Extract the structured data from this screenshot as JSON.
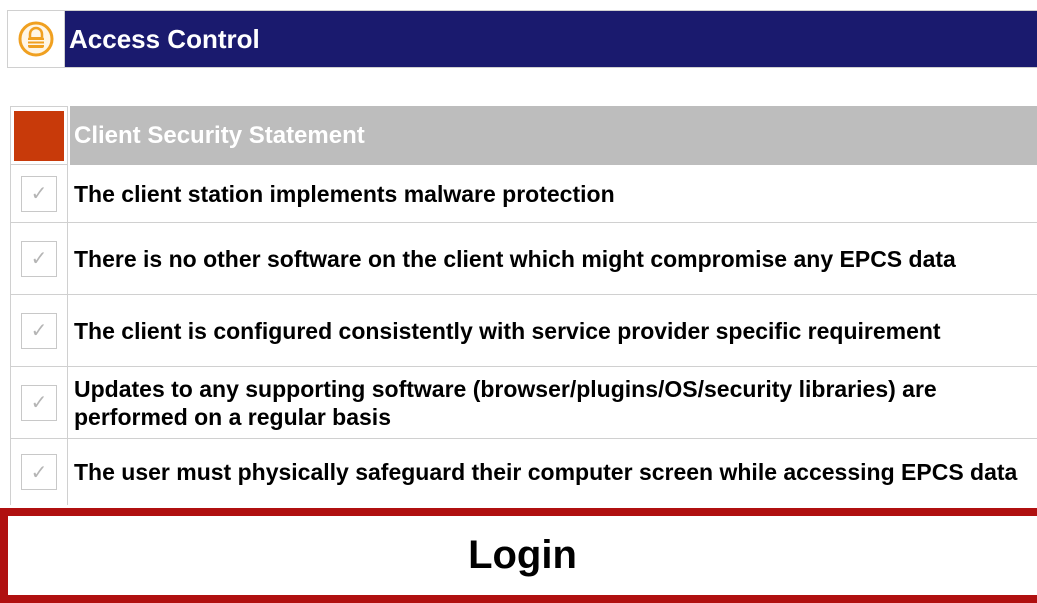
{
  "header": {
    "title": "Access Control",
    "icon": "lock-icon",
    "icon_color": "#f0a020",
    "bar_color": "#1a1a6e"
  },
  "statement": {
    "title": "Client Security Statement",
    "accent_color": "#c83a0a",
    "items": [
      {
        "text": "The client station implements malware protection",
        "checked": true
      },
      {
        "text": "There is no other software on the client which might compromise any EPCS data",
        "checked": true
      },
      {
        "text": "The client is configured consistently with service provider specific requirement",
        "checked": true
      },
      {
        "text": "Updates to any supporting software (browser/plugins/OS/security libraries) are performed on a regular basis",
        "checked": true
      },
      {
        "text": "The user must physically safeguard their computer screen while accessing EPCS data",
        "checked": true
      }
    ]
  },
  "login": {
    "label": "Login",
    "border_color": "#b01010"
  }
}
